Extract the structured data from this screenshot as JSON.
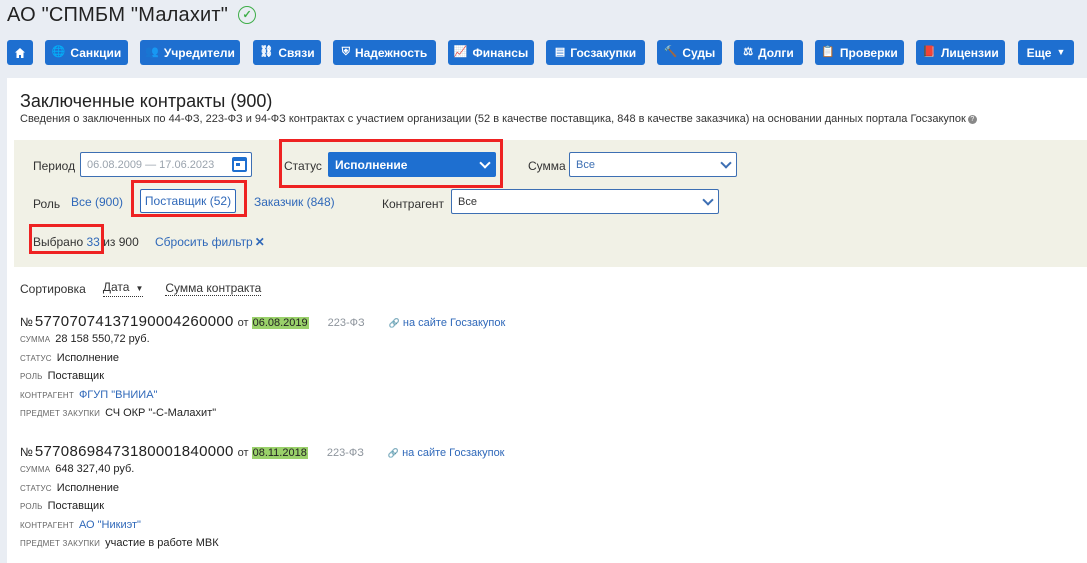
{
  "company": {
    "name": "АО \"СПМБМ \"Малахит\""
  },
  "nav": {
    "home_icon": "home-icon",
    "items": [
      {
        "label": "Санкции",
        "icon": "globe-icon"
      },
      {
        "label": "Учредители",
        "icon": "users-icon"
      },
      {
        "label": "Связи",
        "icon": "network-icon"
      },
      {
        "label": "Надежность",
        "icon": "shield-icon"
      },
      {
        "label": "Финансы",
        "icon": "chart-icon"
      },
      {
        "label": "Госзакупки",
        "icon": "document-icon"
      },
      {
        "label": "Суды",
        "icon": "gavel-icon"
      },
      {
        "label": "Долги",
        "icon": "scales-icon"
      },
      {
        "label": "Проверки",
        "icon": "clipboard-icon"
      },
      {
        "label": "Лицензии",
        "icon": "book-icon"
      },
      {
        "label": "Еще",
        "icon": "chevron-down-icon"
      }
    ]
  },
  "section": {
    "title": "Заключенные контракты (900)",
    "subtitle": "Сведения о заключенных по 44-ФЗ, 223-ФЗ и 94-ФЗ контрактах с участием организации (52 в качестве поставщика, 848 в качестве заказчика) на основании данных портала Госзакупок"
  },
  "filters": {
    "period_label": "Период",
    "period_placeholder": "06.08.2009 — 17.06.2023",
    "status_label": "Статус",
    "status_value": "Исполнение",
    "sum_label": "Сумма",
    "sum_value": "Все",
    "role_label": "Роль",
    "role_all": "Все (900)",
    "role_supplier": "Поставщик (52)",
    "role_customer": "Заказчик (848)",
    "counterparty_label": "Контрагент",
    "counterparty_value": "Все",
    "selected_label": "Выбрано",
    "selected_count": "33",
    "selected_of": "из 900",
    "reset_label": "Сбросить фильтр"
  },
  "sort": {
    "label": "Сортировка",
    "date": "Дата",
    "amount": "Сумма контракта"
  },
  "field_labels": {
    "sum": "сумма",
    "status": "статус",
    "role": "роль",
    "counterparty": "контрагент",
    "subject": "предмет закупки"
  },
  "contracts": [
    {
      "no_prefix": "№",
      "number": "57707074137190004260000",
      "ot": "от",
      "date": "06.08.2019",
      "law": "223-ФЗ",
      "link": "на сайте Госзакупок",
      "sum": "28 158 550,72 руб.",
      "status": "Исполнение",
      "role": "Поставщик",
      "counterparty": "ФГУП \"ВНИИА\"",
      "subject": "СЧ ОКР \"-С-Малахит\""
    },
    {
      "no_prefix": "№",
      "number": "57708698473180001840000",
      "ot": "от",
      "date": "08.11.2018",
      "law": "223-ФЗ",
      "link": "на сайте Госзакупок",
      "sum": "648 327,40 руб.",
      "status": "Исполнение",
      "role": "Поставщик",
      "counterparty": "АО \"Никиэт\"",
      "subject": "участие в работе МВК"
    }
  ],
  "colors": {
    "primary": "#1e6fd0",
    "link": "#2f68b9",
    "highlight_box": "#e22222",
    "date_bg": "#9ad16a",
    "filter_bg": "#f1f1e6",
    "page_bg": "#e9edf3",
    "check": "#3fae49"
  }
}
